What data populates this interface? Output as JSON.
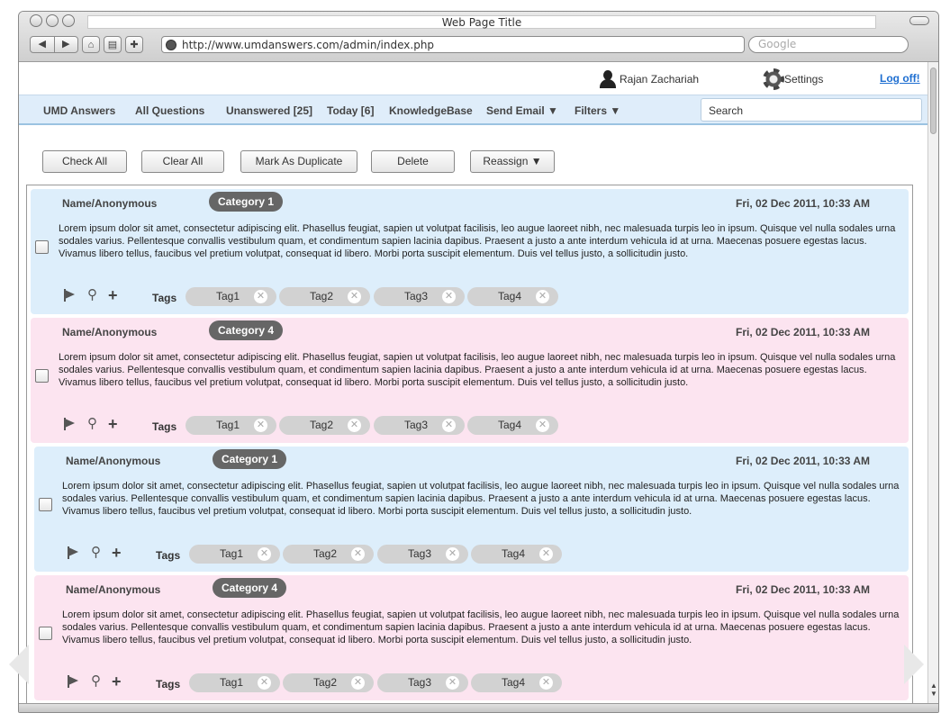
{
  "browser": {
    "window_title": "Web Page Title",
    "url": "http://www.umdanswers.com/admin/index.php",
    "search_placeholder": "Google"
  },
  "header": {
    "user_name": "Rajan Zachariah",
    "settings_label": "Settings",
    "logoff_label": "Log off!"
  },
  "nav": {
    "items": [
      {
        "label": "UMD Answers"
      },
      {
        "label": "All Questions"
      },
      {
        "label": "Unanswered [25]"
      },
      {
        "label": "Today [6]"
      },
      {
        "label": "KnowledgeBase"
      },
      {
        "label": "Send Email ▼"
      },
      {
        "label": "Filters ▼"
      }
    ],
    "search_placeholder": "Search"
  },
  "actions": {
    "check_all": "Check All",
    "clear_all": "Clear All",
    "mark_duplicate": "Mark As Duplicate",
    "delete": "Delete",
    "reassign": "Reassign ▼"
  },
  "questions": [
    {
      "name": "Name/Anonymous",
      "category": "Category  1",
      "date": "Fri,  02 Dec 2011, 10:33 AM",
      "body": "Lorem ipsum dolor sit amet, consectetur adipiscing elit. Phasellus feugiat, sapien ut volutpat facilisis, leo augue laoreet nibh, nec malesuada turpis leo in ipsum. Quisque vel nulla sodales urna sodales varius. Pellentesque convallis vestibulum quam, et condimentum sapien lacinia dapibus. Praesent a justo a ante interdum vehicula id at urna. Maecenas posuere egestas lacus. Vivamus libero tellus, faucibus vel pretium volutpat, consequat id libero. Morbi porta suscipit elementum. Duis vel tellus justo, a sollicitudin justo.",
      "tags_label": "Tags",
      "tags": [
        "Tag1",
        "Tag2",
        "Tag3",
        "Tag4"
      ],
      "color": "blue"
    },
    {
      "name": "Name/Anonymous",
      "category": "Category  4",
      "date": "Fri,  02 Dec 2011, 10:33 AM",
      "body": "Lorem ipsum dolor sit amet, consectetur adipiscing elit. Phasellus feugiat, sapien ut volutpat facilisis, leo augue laoreet nibh, nec malesuada turpis leo in ipsum. Quisque vel nulla sodales urna sodales varius. Pellentesque convallis vestibulum quam, et condimentum sapien lacinia dapibus. Praesent a justo a ante interdum vehicula id at urna. Maecenas posuere egestas lacus. Vivamus libero tellus, faucibus vel pretium volutpat, consequat id libero. Morbi porta suscipit elementum. Duis vel tellus justo, a sollicitudin justo.",
      "tags_label": "Tags",
      "tags": [
        "Tag1",
        "Tag2",
        "Tag3",
        "Tag4"
      ],
      "color": "pink"
    },
    {
      "name": "Name/Anonymous",
      "category": "Category  1",
      "date": "Fri,  02 Dec 2011, 10:33 AM",
      "body": "Lorem ipsum dolor sit amet, consectetur adipiscing elit. Phasellus feugiat, sapien ut volutpat facilisis, leo augue laoreet nibh, nec malesuada turpis leo in ipsum. Quisque vel nulla sodales urna sodales varius. Pellentesque convallis vestibulum quam, et condimentum sapien lacinia dapibus. Praesent a justo a ante interdum vehicula id at urna. Maecenas posuere egestas lacus. Vivamus libero tellus, faucibus vel pretium volutpat, consequat id libero. Morbi porta suscipit elementum. Duis vel tellus justo, a sollicitudin justo.",
      "tags_label": "Tags",
      "tags": [
        "Tag1",
        "Tag2",
        "Tag3",
        "Tag4"
      ],
      "color": "blue"
    },
    {
      "name": "Name/Anonymous",
      "category": "Category  4",
      "date": "Fri,  02 Dec 2011, 10:33 AM",
      "body": "Lorem ipsum dolor sit amet, consectetur adipiscing elit. Phasellus feugiat, sapien ut volutpat facilisis, leo augue laoreet nibh, nec malesuada turpis leo in ipsum. Quisque vel nulla sodales urna sodales varius. Pellentesque convallis vestibulum quam, et condimentum sapien lacinia dapibus. Praesent a justo a ante interdum vehicula id at urna. Maecenas posuere egestas lacus. Vivamus libero tellus, faucibus vel pretium volutpat, consequat id libero. Morbi porta suscipit elementum. Duis vel tellus justo, a sollicitudin justo.",
      "tags_label": "Tags",
      "tags": [
        "Tag1",
        "Tag2",
        "Tag3",
        "Tag4"
      ],
      "color": "pink"
    }
  ],
  "colors": {
    "blue_row": "#ddeefb",
    "pink_row": "#fce4f0",
    "nav_bg": "#dfedfa",
    "link": "#1f6fd1"
  }
}
